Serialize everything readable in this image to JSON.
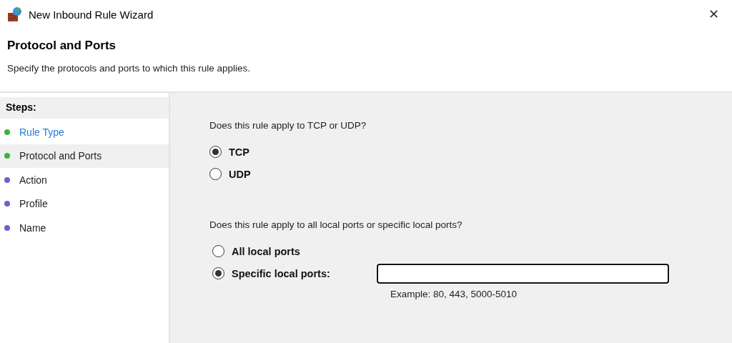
{
  "window": {
    "title": "New Inbound Rule Wizard",
    "close": "✕"
  },
  "header": {
    "title": "Protocol and Ports",
    "subtitle": "Specify the protocols and ports to which this rule applies."
  },
  "sidebar": {
    "title": "Steps:",
    "items": [
      {
        "label": "Rule Type",
        "color": "#3cb43c",
        "selected": false,
        "link": true
      },
      {
        "label": "Protocol and Ports",
        "color": "#3cb43c",
        "selected": true,
        "link": false
      },
      {
        "label": "Action",
        "color": "#6a5fd0",
        "selected": false,
        "link": false
      },
      {
        "label": "Profile",
        "color": "#6a5fd0",
        "selected": false,
        "link": false
      },
      {
        "label": "Name",
        "color": "#6a5fd0",
        "selected": false,
        "link": false
      }
    ]
  },
  "protocol": {
    "question": "Does this rule apply to TCP or UDP?",
    "options": [
      {
        "label": "TCP",
        "selected": true
      },
      {
        "label": "UDP",
        "selected": false
      }
    ]
  },
  "ports": {
    "question": "Does this rule apply to all local ports or specific local ports?",
    "options": [
      {
        "label": "All local ports",
        "selected": false
      },
      {
        "label": "Specific local ports:",
        "selected": true
      }
    ],
    "field": {
      "focused": true
    },
    "example": "Example: 80, 443, 5000-5010"
  }
}
